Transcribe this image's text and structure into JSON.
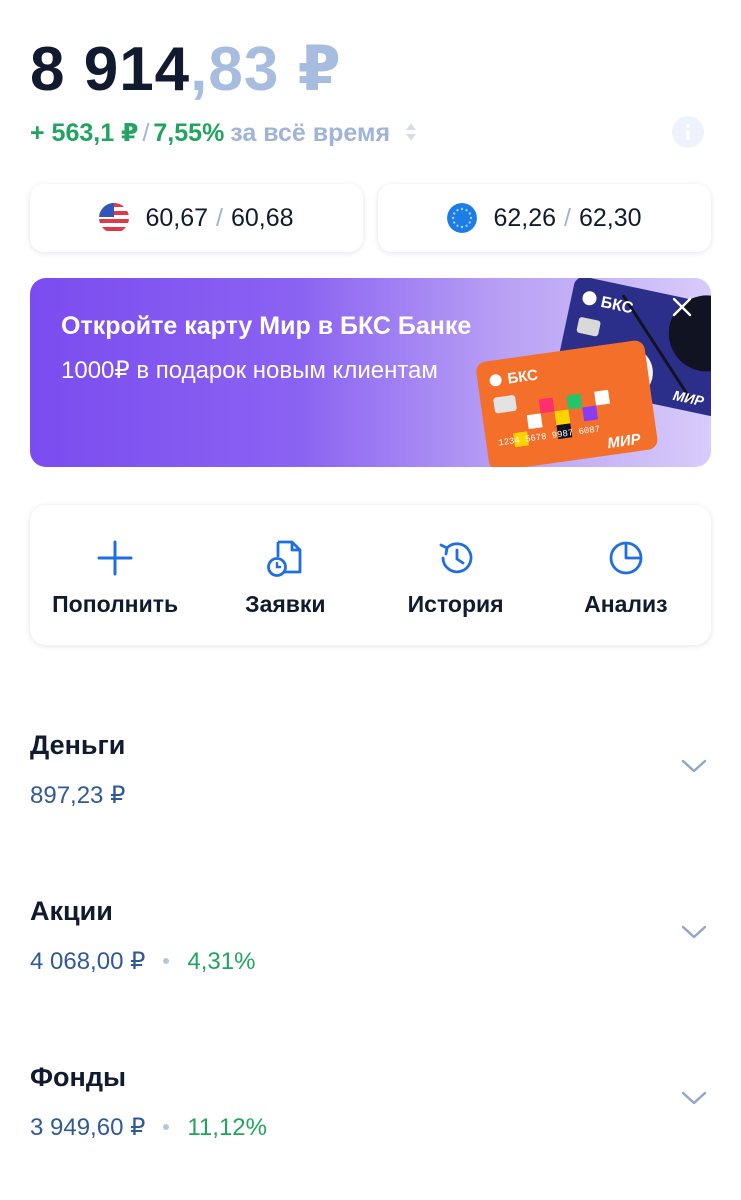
{
  "balance": {
    "integer": "8 914",
    "fraction": ",83 ₽"
  },
  "gain": {
    "absolute": "+ 563,1 ₽",
    "separator": "/",
    "percent": "7,55%",
    "period": "за всё время"
  },
  "rates": [
    {
      "flag": "us-flag-icon",
      "buy": "60,67",
      "sep": "/",
      "sell": "60,68"
    },
    {
      "flag": "eu-flag-icon",
      "buy": "62,26",
      "sep": "/",
      "sell": "62,30"
    }
  ],
  "promo": {
    "title": "Откройте карту Мир в БКС Банке",
    "subtitle": "1000₽ в подарок новым клиентам",
    "card_brand": "БКС",
    "card_network": "МИР",
    "card_number": "1234 5678 9987 6087"
  },
  "actions": [
    {
      "label": "Пополнить",
      "icon": "plus-icon"
    },
    {
      "label": "Заявки",
      "icon": "document-clock-icon"
    },
    {
      "label": "История",
      "icon": "history-icon"
    },
    {
      "label": "Анализ",
      "icon": "pie-chart-icon"
    }
  ],
  "sections": [
    {
      "name": "Деньги",
      "value": "897,23 ₽",
      "percent": ""
    },
    {
      "name": "Акции",
      "value": "4 068,00 ₽",
      "percent": "4,31%"
    },
    {
      "name": "Фонды",
      "value": "3 949,60 ₽",
      "percent": "11,12%"
    }
  ],
  "colors": {
    "accent": "#1f6fe0",
    "positive": "#22a460",
    "muted": "#9fb4d6",
    "value": "#2f5a96"
  }
}
